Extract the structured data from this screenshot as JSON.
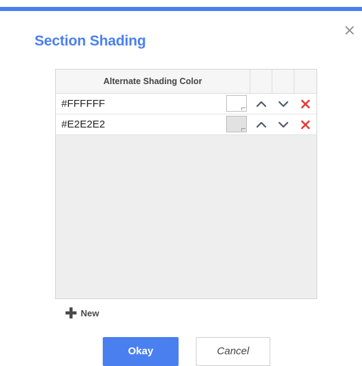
{
  "dialog": {
    "title": "Section Shading"
  },
  "table": {
    "header": "Alternate Shading Color",
    "rows": [
      {
        "value": "#FFFFFF",
        "swatch_color": "#FFFFFF"
      },
      {
        "value": "#E2E2E2",
        "swatch_color": "#E2E2E2"
      }
    ]
  },
  "actions": {
    "new_label": "New",
    "okay_label": "Okay",
    "cancel_label": "Cancel"
  },
  "icons": {
    "close": "close-icon",
    "move_up": "chevron-up-icon",
    "move_down": "chevron-down-icon",
    "delete": "delete-x-icon",
    "add": "plus-icon"
  },
  "colors": {
    "accent": "#4A7FF0",
    "delete": "#E53935",
    "table_background": "#EEEEEE"
  }
}
